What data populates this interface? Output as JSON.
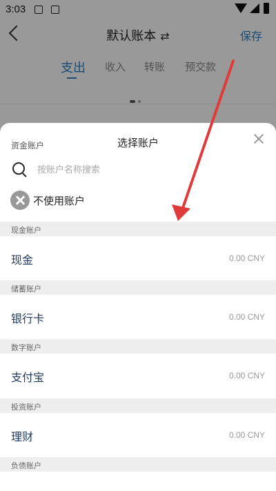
{
  "status_bar": {
    "time": "3:03"
  },
  "header": {
    "title": "默认账本",
    "save_label": "保存"
  },
  "tabs": [
    {
      "label": "支出",
      "active": true
    },
    {
      "label": "收入"
    },
    {
      "label": "转账"
    },
    {
      "label": "预交款"
    }
  ],
  "sheet": {
    "left_label": "资金账户",
    "title": "选择账户",
    "search_placeholder": "按账户名称搜索",
    "no_account_label": "不使用账户",
    "sections": [
      {
        "header": "现金账户",
        "account": {
          "name": "现金",
          "balance": "0.00 CNY"
        }
      },
      {
        "header": "储蓄账户",
        "account": {
          "name": "银行卡",
          "balance": "0.00 CNY"
        }
      },
      {
        "header": "数字账户",
        "account": {
          "name": "支付宝",
          "balance": "0.00 CNY"
        }
      },
      {
        "header": "投资账户",
        "account": {
          "name": "理财",
          "balance": "0.00 CNY"
        }
      },
      {
        "header": "负债账户"
      }
    ]
  },
  "colors": {
    "accent": "#2f7dc2",
    "annotation_arrow": "#e03a3a"
  },
  "icons": [
    "back-icon",
    "sync-icon",
    "close-icon",
    "search-icon",
    "no-account-icon"
  ]
}
